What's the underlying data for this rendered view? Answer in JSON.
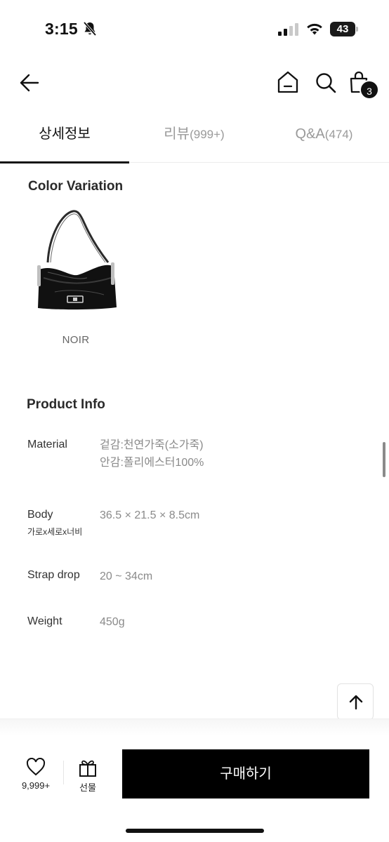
{
  "status_bar": {
    "time": "3:15",
    "battery_level": "43"
  },
  "header": {
    "cart_count": "3"
  },
  "tabs": [
    {
      "label": "상세정보",
      "count": ""
    },
    {
      "label": "리뷰",
      "count": "(999+)"
    },
    {
      "label": "Q&A",
      "count": "(474)"
    }
  ],
  "color_variation": {
    "title": "Color Variation",
    "items": [
      {
        "caption": "NOIR"
      }
    ]
  },
  "product_info": {
    "title": "Product Info",
    "rows": [
      {
        "label": "Material",
        "sublabel": "",
        "values": [
          "겉감:천연가죽(소가죽)",
          "안감:폴리에스터100%"
        ]
      },
      {
        "label": "Body",
        "sublabel": "가로x세로x너비",
        "values": [
          "36.5 × 21.5 × 8.5cm"
        ]
      },
      {
        "label": "Strap drop",
        "sublabel": "",
        "values": [
          "20 ~ 34cm"
        ]
      },
      {
        "label": "Weight",
        "sublabel": "",
        "values": [
          "450g"
        ]
      }
    ]
  },
  "bottom_bar": {
    "like_count": "9,999+",
    "gift_label": "선물",
    "buy_label": "구매하기"
  }
}
